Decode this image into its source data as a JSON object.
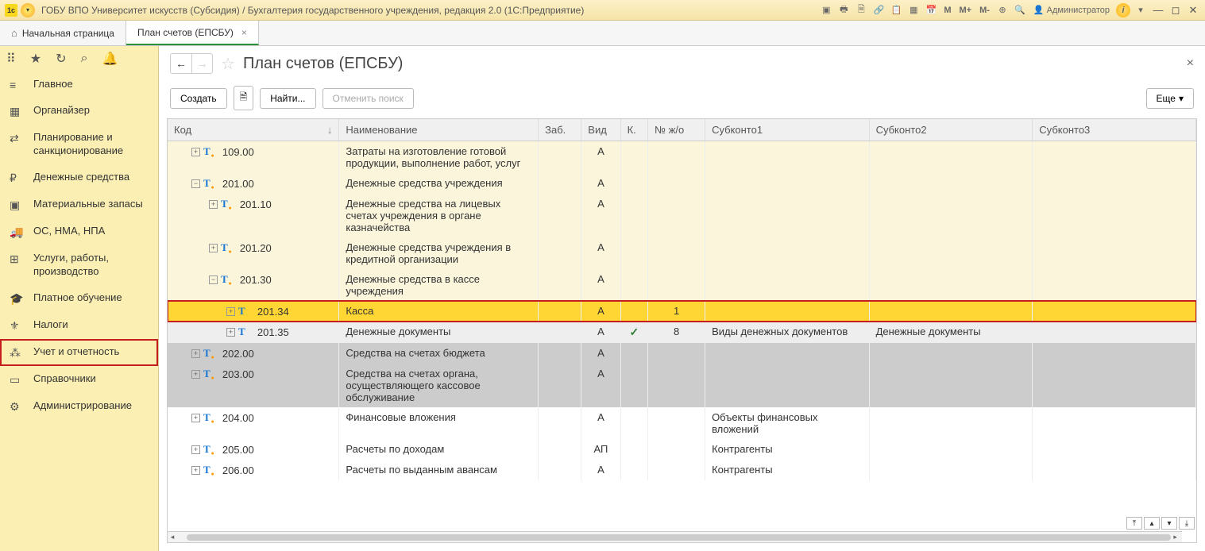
{
  "titlebar": {
    "logo": "1c",
    "title": "ГОБУ ВПО Университет искусств (Субсидия) / Бухгалтерия государственного учреждения, редакция 2.0  (1С:Предприятие)",
    "m_buttons": [
      "M",
      "M+",
      "M-"
    ],
    "user": "Администратор",
    "info": "i"
  },
  "tabs": {
    "home": "Начальная страница",
    "active": "План счетов (ЕПСБУ)"
  },
  "sidebar": {
    "items": [
      {
        "icon": "≡",
        "label": "Главное"
      },
      {
        "icon": "▦",
        "label": "Органайзер"
      },
      {
        "icon": "⇄",
        "label": "Планирование и санкционирование"
      },
      {
        "icon": "₽",
        "label": "Денежные средства"
      },
      {
        "icon": "▣",
        "label": "Материальные запасы"
      },
      {
        "icon": "🚚",
        "label": "ОС, НМА, НПА"
      },
      {
        "icon": "⊞",
        "label": "Услуги, работы, производство"
      },
      {
        "icon": "🎓",
        "label": "Платное обучение"
      },
      {
        "icon": "⚜",
        "label": "Налоги"
      },
      {
        "icon": "⁂",
        "label": "Учет и отчетность"
      },
      {
        "icon": "▭",
        "label": "Справочники"
      },
      {
        "icon": "⚙",
        "label": "Администрирование"
      }
    ]
  },
  "page": {
    "title": "План счетов (ЕПСБУ)",
    "create": "Создать",
    "find": "Найти...",
    "cancel_search": "Отменить поиск",
    "more": "Еще"
  },
  "table": {
    "headers": {
      "code": "Код",
      "name": "Наименование",
      "zab": "Заб.",
      "vid": "Вид",
      "k": "К.",
      "zho": "№ ж/о",
      "sub1": "Субконто1",
      "sub2": "Субконто2",
      "sub3": "Субконто3"
    },
    "rows": [
      {
        "cls": "row-beige",
        "indent": 1,
        "exp": "+",
        "icon": "orange-dot",
        "code": "109.00",
        "name": "Затраты на изготовление готовой продукции, выполнение работ, услуг",
        "vid": "А",
        "k": "",
        "zho": "",
        "sub1": "",
        "sub2": "",
        "sub3": ""
      },
      {
        "cls": "row-beige",
        "indent": 1,
        "exp": "−",
        "icon": "orange-dot",
        "code": "201.00",
        "name": "Денежные средства учреждения",
        "vid": "А",
        "k": "",
        "zho": "",
        "sub1": "",
        "sub2": "",
        "sub3": ""
      },
      {
        "cls": "row-beige",
        "indent": 2,
        "exp": "+",
        "icon": "orange-dot",
        "code": "201.10",
        "name": "Денежные средства на лицевых счетах учреждения в органе казначейства",
        "vid": "А",
        "k": "",
        "zho": "",
        "sub1": "",
        "sub2": "",
        "sub3": ""
      },
      {
        "cls": "row-beige",
        "indent": 2,
        "exp": "+",
        "icon": "orange-dot",
        "code": "201.20",
        "name": "Денежные средства учреждения в кредитной организации",
        "vid": "А",
        "k": "",
        "zho": "",
        "sub1": "",
        "sub2": "",
        "sub3": ""
      },
      {
        "cls": "row-beige",
        "indent": 2,
        "exp": "−",
        "icon": "orange-dot",
        "code": "201.30",
        "name": "Денежные средства  в кассе учреждения",
        "vid": "А",
        "k": "",
        "zho": "",
        "sub1": "",
        "sub2": "",
        "sub3": ""
      },
      {
        "cls": "row-highlight",
        "indent": 3,
        "exp": "+",
        "icon": "blue",
        "code": "201.34",
        "name": "Касса",
        "vid": "А",
        "k": "",
        "zho": "1",
        "sub1": "",
        "sub2": "",
        "sub3": ""
      },
      {
        "cls": "row-white hover",
        "indent": 3,
        "exp": "+",
        "icon": "blue",
        "code": "201.35",
        "name": "Денежные документы",
        "vid": "А",
        "k": "✓",
        "zho": "8",
        "sub1": "Виды денежных документов",
        "sub2": "Денежные документы",
        "sub3": ""
      },
      {
        "cls": "row-grey",
        "indent": 1,
        "exp": "+",
        "icon": "orange-dot",
        "code": "202.00",
        "name": "Средства на счетах бюджета",
        "vid": "А",
        "k": "",
        "zho": "",
        "sub1": "",
        "sub2": "",
        "sub3": ""
      },
      {
        "cls": "row-grey",
        "indent": 1,
        "exp": "+",
        "icon": "orange-dot",
        "code": "203.00",
        "name": "Средства на счетах органа, осуществляющего кассовое обслуживание",
        "vid": "А",
        "k": "",
        "zho": "",
        "sub1": "",
        "sub2": "",
        "sub3": ""
      },
      {
        "cls": "row-white",
        "indent": 1,
        "exp": "+",
        "icon": "orange-dot",
        "code": "204.00",
        "name": "Финансовые вложения",
        "vid": "А",
        "k": "",
        "zho": "",
        "sub1": "Объекты финансовых вложений",
        "sub2": "",
        "sub3": ""
      },
      {
        "cls": "row-white",
        "indent": 1,
        "exp": "+",
        "icon": "orange-dot",
        "code": "205.00",
        "name": "Расчеты по доходам",
        "vid": "АП",
        "k": "",
        "zho": "",
        "sub1": "Контрагенты",
        "sub2": "",
        "sub3": ""
      },
      {
        "cls": "row-white",
        "indent": 1,
        "exp": "+",
        "icon": "orange-dot",
        "code": "206.00",
        "name": "Расчеты по выданным авансам",
        "vid": "А",
        "k": "",
        "zho": "",
        "sub1": "Контрагенты",
        "sub2": "",
        "sub3": ""
      }
    ]
  }
}
